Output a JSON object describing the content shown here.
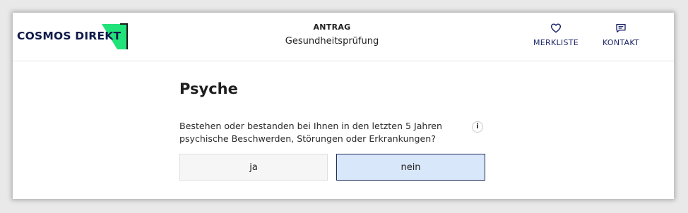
{
  "header": {
    "logo_text": "COSMOS DIREKT",
    "breadcrumb_top": "ANTRAG",
    "breadcrumb_sub": "Gesundheitsprüfung",
    "nav": [
      {
        "label": "MERKLISTE",
        "icon": "heart-icon"
      },
      {
        "label": "KONTAKT",
        "icon": "chat-icon"
      }
    ]
  },
  "main": {
    "heading": "Psyche",
    "question": "Bestehen oder bestanden bei Ihnen in den letzten 5 Jahren psychische Beschwerden, Störungen oder Erkrankungen?",
    "info_symbol": "i",
    "answers": [
      "ja",
      "nein"
    ],
    "selected": "nein"
  },
  "colors": {
    "brand_navy": "#1b2466",
    "logo_green": "#22e27a",
    "selected_bg": "#d9e7fb",
    "selected_border": "#1d2a5c"
  }
}
